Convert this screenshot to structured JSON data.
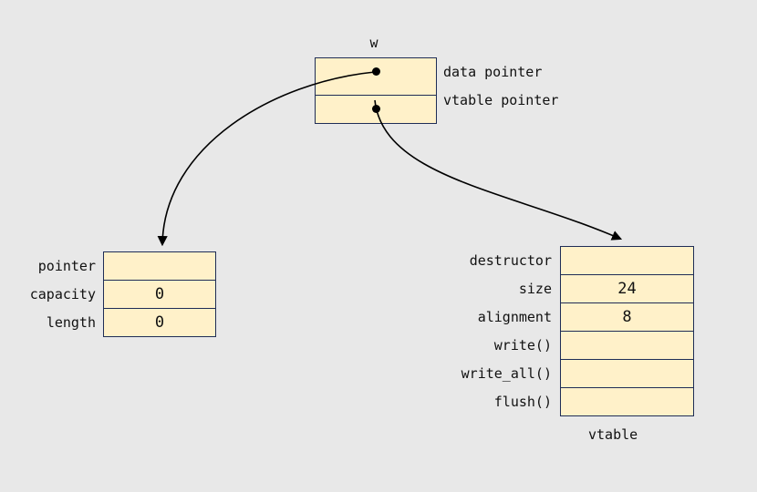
{
  "w": {
    "title": "w",
    "rows": [
      {
        "label": "data pointer"
      },
      {
        "label": "vtable pointer"
      }
    ]
  },
  "data_box": {
    "rows": [
      {
        "label": "pointer",
        "value": ""
      },
      {
        "label": "capacity",
        "value": "0"
      },
      {
        "label": "length",
        "value": "0"
      }
    ]
  },
  "vtable": {
    "caption": "vtable",
    "rows": [
      {
        "label": "destructor",
        "value": ""
      },
      {
        "label": "size",
        "value": "24"
      },
      {
        "label": "alignment",
        "value": "8"
      },
      {
        "label": "write()",
        "value": ""
      },
      {
        "label": "write_all()",
        "value": ""
      },
      {
        "label": "flush()",
        "value": ""
      }
    ]
  }
}
